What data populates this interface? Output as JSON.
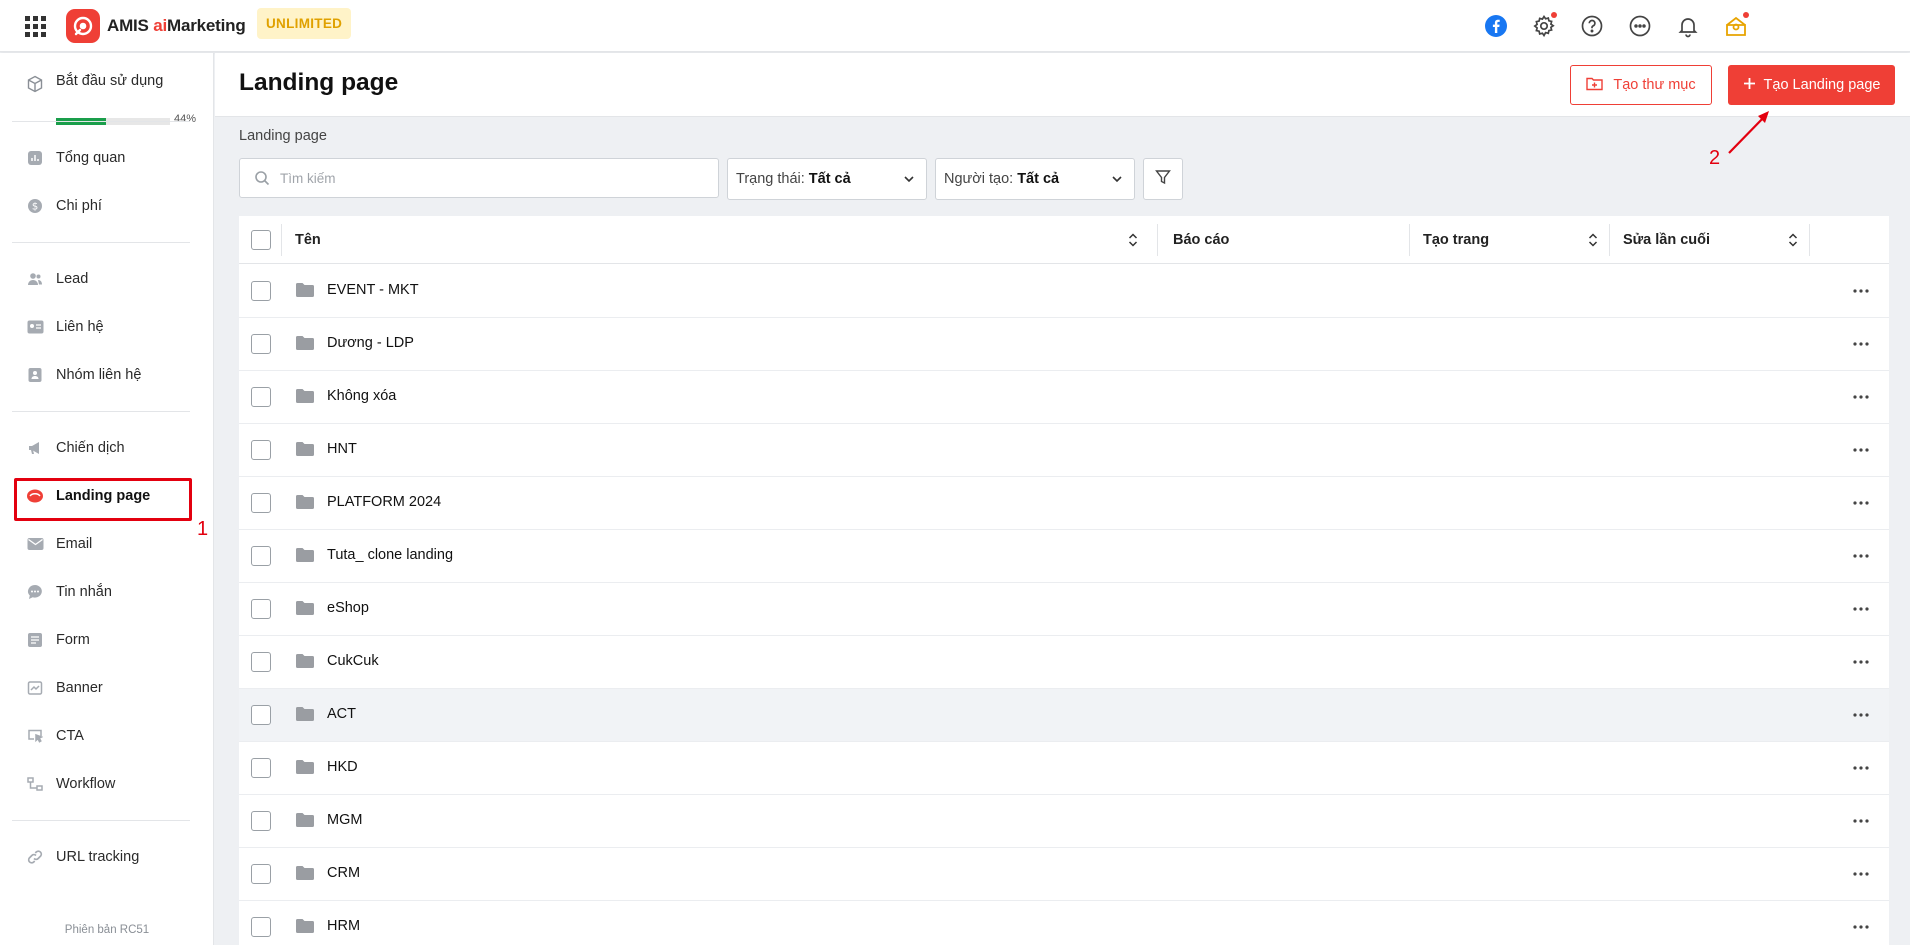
{
  "app": {
    "brand_prefix": "AMIS ",
    "brand_ai": "ai",
    "brand_suffix": "Marketing",
    "plan": "UNLIMITED"
  },
  "topbar": {
    "icons": [
      "facebook-icon",
      "settings-icon",
      "help-icon",
      "more-icon",
      "notification-icon",
      "gift-icon"
    ]
  },
  "sidebar": {
    "onboarding": {
      "label": "Bắt đầu sử dụng",
      "percent_text": "44%",
      "progress": 0.44
    },
    "items": [
      {
        "label": "Tổng quan",
        "icon": "chart-icon"
      },
      {
        "label": "Chi phí",
        "icon": "dollar-icon"
      },
      {
        "label": "Lead",
        "icon": "users-icon"
      },
      {
        "label": "Liên hệ",
        "icon": "contact-card-icon"
      },
      {
        "label": "Nhóm liên hệ",
        "icon": "contact-group-icon"
      },
      {
        "label": "Chiến dịch",
        "icon": "megaphone-icon"
      },
      {
        "label": "Landing page",
        "icon": "landing-page-icon",
        "active": true
      },
      {
        "label": "Email",
        "icon": "email-icon"
      },
      {
        "label": "Tin nhắn",
        "icon": "message-icon"
      },
      {
        "label": "Form",
        "icon": "form-icon"
      },
      {
        "label": "Banner",
        "icon": "banner-icon"
      },
      {
        "label": "CTA",
        "icon": "cta-icon"
      },
      {
        "label": "Workflow",
        "icon": "workflow-icon"
      },
      {
        "label": "URL tracking",
        "icon": "link-icon"
      }
    ],
    "version": "Phiên bản RC51"
  },
  "annotations": {
    "one": "1",
    "two": "2"
  },
  "header": {
    "title": "Landing page",
    "folder_button": "Tạo thư mục",
    "create_button": "Tạo Landing page"
  },
  "filters": {
    "breadcrumb": "Landing page",
    "search_placeholder": "Tìm kiếm",
    "status_label": "Trạng thái:",
    "status_value": "Tất cả",
    "creator_label": "Người tạo:",
    "creator_value": "Tất cả"
  },
  "table": {
    "columns": [
      "Tên",
      "Báo cáo",
      "Tạo trang",
      "Sửa lần cuối"
    ],
    "rows": [
      {
        "name": "EVENT - MKT"
      },
      {
        "name": "Dương - LDP"
      },
      {
        "name": "Không xóa"
      },
      {
        "name": "HNT"
      },
      {
        "name": "PLATFORM 2024"
      },
      {
        "name": "Tuta_ clone landing"
      },
      {
        "name": "eShop"
      },
      {
        "name": "CukCuk"
      },
      {
        "name": "ACT"
      },
      {
        "name": "HKD"
      },
      {
        "name": "MGM"
      },
      {
        "name": "CRM"
      },
      {
        "name": "HRM"
      }
    ]
  },
  "colors": {
    "accent": "#ef3f36",
    "progress": "#1a9e4b",
    "annotation": "#e3000f"
  }
}
